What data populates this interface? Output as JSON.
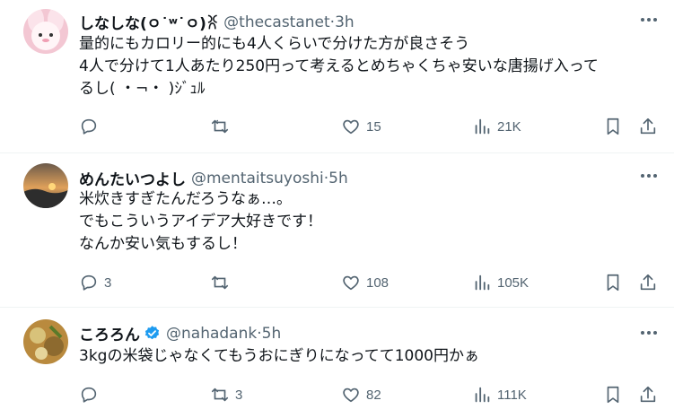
{
  "tweets": [
    {
      "name": "しなしな(ㅇ˙ʷ˙ㅇ)ꐦ",
      "handle": "@thecastanet",
      "sep": " · ",
      "time": "3h",
      "lines": [
        "量的にもカロリー的にも4人くらいで分けた方が良さそう",
        "4人で分けて1人あたり250円って考えるとめちゃくちゃ安いな唐揚げ入って",
        "るし( ・¬・ )ｼﾞｭﾙ"
      ],
      "replies": "",
      "reposts": "",
      "likes": "15",
      "views": "21K",
      "verified": false
    },
    {
      "name": "めんたいつよし",
      "handle": "@mentaitsuyoshi",
      "sep": " · ",
      "time": "5h",
      "lines": [
        "米炊きすぎたんだろうなぁ…。",
        "でもこういうアイデア大好きです！",
        "なんか安い気もするし！"
      ],
      "replies": "3",
      "reposts": "",
      "likes": "108",
      "views": "105K",
      "verified": false
    },
    {
      "name": "ころろん",
      "handle": "@nahadank",
      "sep": " · ",
      "time": "5h",
      "lines": [
        "3kgの米袋じゃなくてもうおにぎりになってて1000円かぁ"
      ],
      "replies": "",
      "reposts": "3",
      "likes": "82",
      "views": "111K",
      "verified": true
    }
  ],
  "colors": {
    "text": "#0f1419",
    "muted": "#536471",
    "verified": "#1d9bf0",
    "border": "#eff3f4"
  },
  "icons": [
    "reply-icon",
    "repost-icon",
    "like-icon",
    "views-icon",
    "bookmark-icon",
    "share-icon",
    "more-icon",
    "verified-icon"
  ]
}
